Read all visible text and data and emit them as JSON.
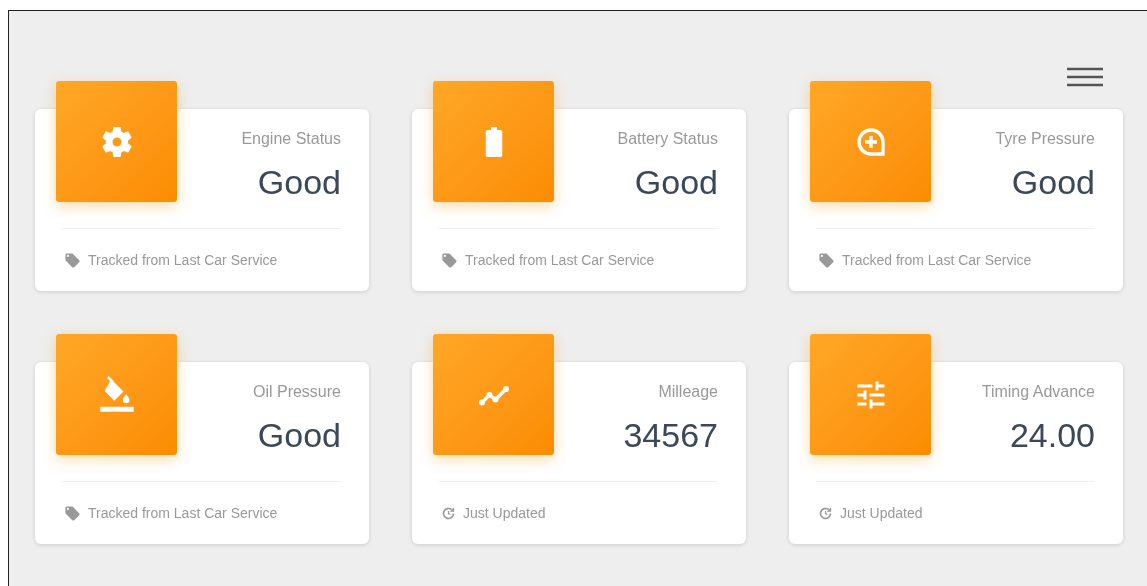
{
  "cards": [
    {
      "kind": "gear",
      "title": "Engine Status",
      "value": "Good",
      "footer": {
        "kind": "tag",
        "text": "Tracked from Last Car Service"
      }
    },
    {
      "kind": "battery",
      "title": "Battery Status",
      "value": "Good",
      "footer": {
        "kind": "tag",
        "text": "Tracked from Last Car Service"
      }
    },
    {
      "kind": "tyre",
      "title": "Tyre Pressure",
      "value": "Good",
      "footer": {
        "kind": "tag",
        "text": "Tracked from Last Car Service"
      }
    },
    {
      "kind": "bucket",
      "title": "Oil Pressure",
      "value": "Good",
      "footer": {
        "kind": "tag",
        "text": "Tracked from Last Car Service"
      }
    },
    {
      "kind": "trend",
      "title": "Milleage",
      "value": "34567",
      "footer": {
        "kind": "update",
        "text": "Just Updated"
      }
    },
    {
      "kind": "sliders",
      "title": "Timing Advance",
      "value": "24.00",
      "footer": {
        "kind": "update",
        "text": "Just Updated"
      }
    }
  ]
}
